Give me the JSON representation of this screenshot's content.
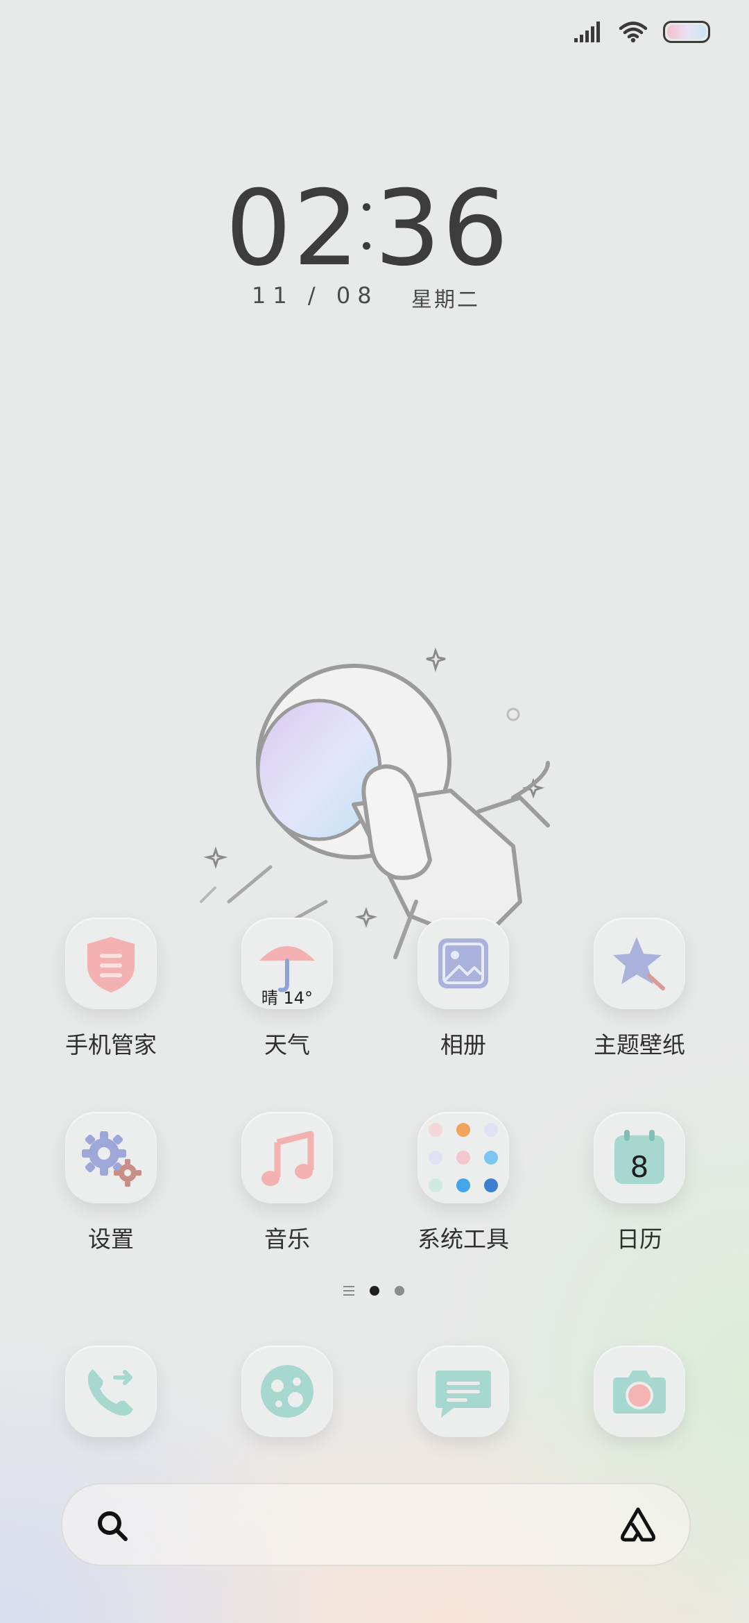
{
  "status_bar": {
    "icons": [
      "signal-icon",
      "wifi-icon",
      "battery-icon"
    ]
  },
  "lockclock": {
    "hour": "02",
    "minute": "36",
    "date": "11 / 08",
    "weekday": "星期二"
  },
  "apps_row1": [
    {
      "label": "手机管家",
      "icon": "shield-icon"
    },
    {
      "label": "天气",
      "icon": "umbrella-icon",
      "badge": "晴 14°"
    },
    {
      "label": "相册",
      "icon": "gallery-icon"
    },
    {
      "label": "主题壁纸",
      "icon": "star-brush-icon"
    }
  ],
  "apps_row2": [
    {
      "label": "设置",
      "icon": "gear-icon"
    },
    {
      "label": "音乐",
      "icon": "music-note-icon"
    },
    {
      "label": "系统工具",
      "icon": "folder-grid-icon"
    },
    {
      "label": "日历",
      "icon": "calendar-icon",
      "day": "8"
    }
  ],
  "dock": [
    {
      "icon": "phone-icon"
    },
    {
      "icon": "browser-icon"
    },
    {
      "icon": "message-icon"
    },
    {
      "icon": "camera-icon"
    }
  ],
  "pager": {
    "pages": 2,
    "active": 1
  },
  "search": {
    "left_icon": "search-icon",
    "right_icon": "assistant-icon"
  },
  "colors": {
    "mint": "#a7d8cf",
    "pink": "#f4b4b4",
    "lavender": "#aab2dc",
    "text": "#2f2f2f"
  }
}
